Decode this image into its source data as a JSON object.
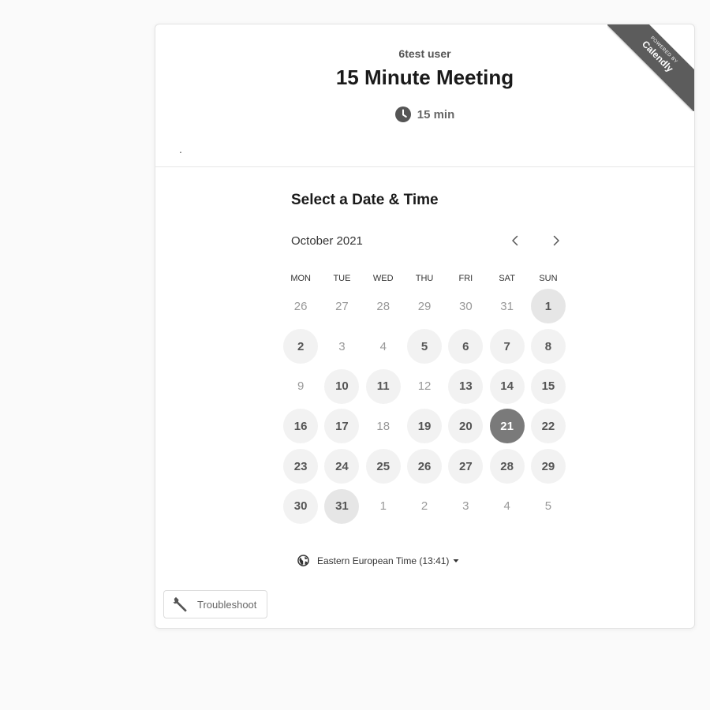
{
  "badge": {
    "line1": "POWERED BY",
    "line2": "Calendly"
  },
  "header": {
    "host": "6test user",
    "title": "15 Minute Meeting",
    "duration": "15 min",
    "description": "."
  },
  "calendar": {
    "heading": "Select a Date & Time",
    "month_label": "October 2021",
    "weekdays": [
      "MON",
      "TUE",
      "WED",
      "THU",
      "FRI",
      "SAT",
      "SUN"
    ],
    "days": [
      {
        "label": "26",
        "state": "disabled"
      },
      {
        "label": "27",
        "state": "disabled"
      },
      {
        "label": "28",
        "state": "disabled"
      },
      {
        "label": "29",
        "state": "disabled"
      },
      {
        "label": "30",
        "state": "disabled"
      },
      {
        "label": "31",
        "state": "disabled"
      },
      {
        "label": "1",
        "state": "today"
      },
      {
        "label": "2",
        "state": "available"
      },
      {
        "label": "3",
        "state": "disabled"
      },
      {
        "label": "4",
        "state": "disabled"
      },
      {
        "label": "5",
        "state": "available"
      },
      {
        "label": "6",
        "state": "available"
      },
      {
        "label": "7",
        "state": "available"
      },
      {
        "label": "8",
        "state": "available"
      },
      {
        "label": "9",
        "state": "disabled"
      },
      {
        "label": "10",
        "state": "available"
      },
      {
        "label": "11",
        "state": "available"
      },
      {
        "label": "12",
        "state": "disabled"
      },
      {
        "label": "13",
        "state": "available"
      },
      {
        "label": "14",
        "state": "available"
      },
      {
        "label": "15",
        "state": "available"
      },
      {
        "label": "16",
        "state": "available"
      },
      {
        "label": "17",
        "state": "available"
      },
      {
        "label": "18",
        "state": "disabled"
      },
      {
        "label": "19",
        "state": "available"
      },
      {
        "label": "20",
        "state": "available"
      },
      {
        "label": "21",
        "state": "selected"
      },
      {
        "label": "22",
        "state": "available"
      },
      {
        "label": "23",
        "state": "available"
      },
      {
        "label": "24",
        "state": "available"
      },
      {
        "label": "25",
        "state": "available"
      },
      {
        "label": "26",
        "state": "available"
      },
      {
        "label": "27",
        "state": "available"
      },
      {
        "label": "28",
        "state": "available"
      },
      {
        "label": "29",
        "state": "available"
      },
      {
        "label": "30",
        "state": "available"
      },
      {
        "label": "31",
        "state": "today"
      },
      {
        "label": "1",
        "state": "disabled"
      },
      {
        "label": "2",
        "state": "disabled"
      },
      {
        "label": "3",
        "state": "disabled"
      },
      {
        "label": "4",
        "state": "disabled"
      },
      {
        "label": "5",
        "state": "disabled"
      }
    ]
  },
  "timezone": {
    "label": "Eastern European Time (13:41)"
  },
  "troubleshoot": {
    "label": "Troubleshoot"
  },
  "icons": {
    "clock": "clock-icon",
    "globe": "globe-icon",
    "caret": "caret-down-icon",
    "prev": "chevron-left-icon",
    "next": "chevron-right-icon",
    "wrench": "wrench-icon"
  }
}
